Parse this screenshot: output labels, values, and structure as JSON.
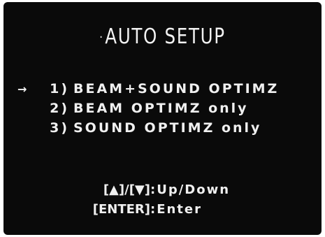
{
  "screen": {
    "title_marker": "·",
    "title": "AUTO SETUP"
  },
  "menu": {
    "cursor_icon": "arrow-right-icon",
    "cursor_glyph": "→",
    "items": [
      {
        "number": "1)",
        "label": "BEAM+SOUND OPTIMZ",
        "selected": true
      },
      {
        "number": "2)",
        "label": "BEAM OPTIMZ only",
        "selected": false
      },
      {
        "number": "3)",
        "label": "SOUND OPTIMZ only",
        "selected": false
      }
    ]
  },
  "help": {
    "rows": [
      {
        "key": "[▲]/[▼]",
        "action": ":Up/Down"
      },
      {
        "key": "[ENTER]",
        "action": ":Enter"
      }
    ]
  },
  "colors": {
    "background": "#0a0a0a",
    "text": "#f0f0f0"
  }
}
